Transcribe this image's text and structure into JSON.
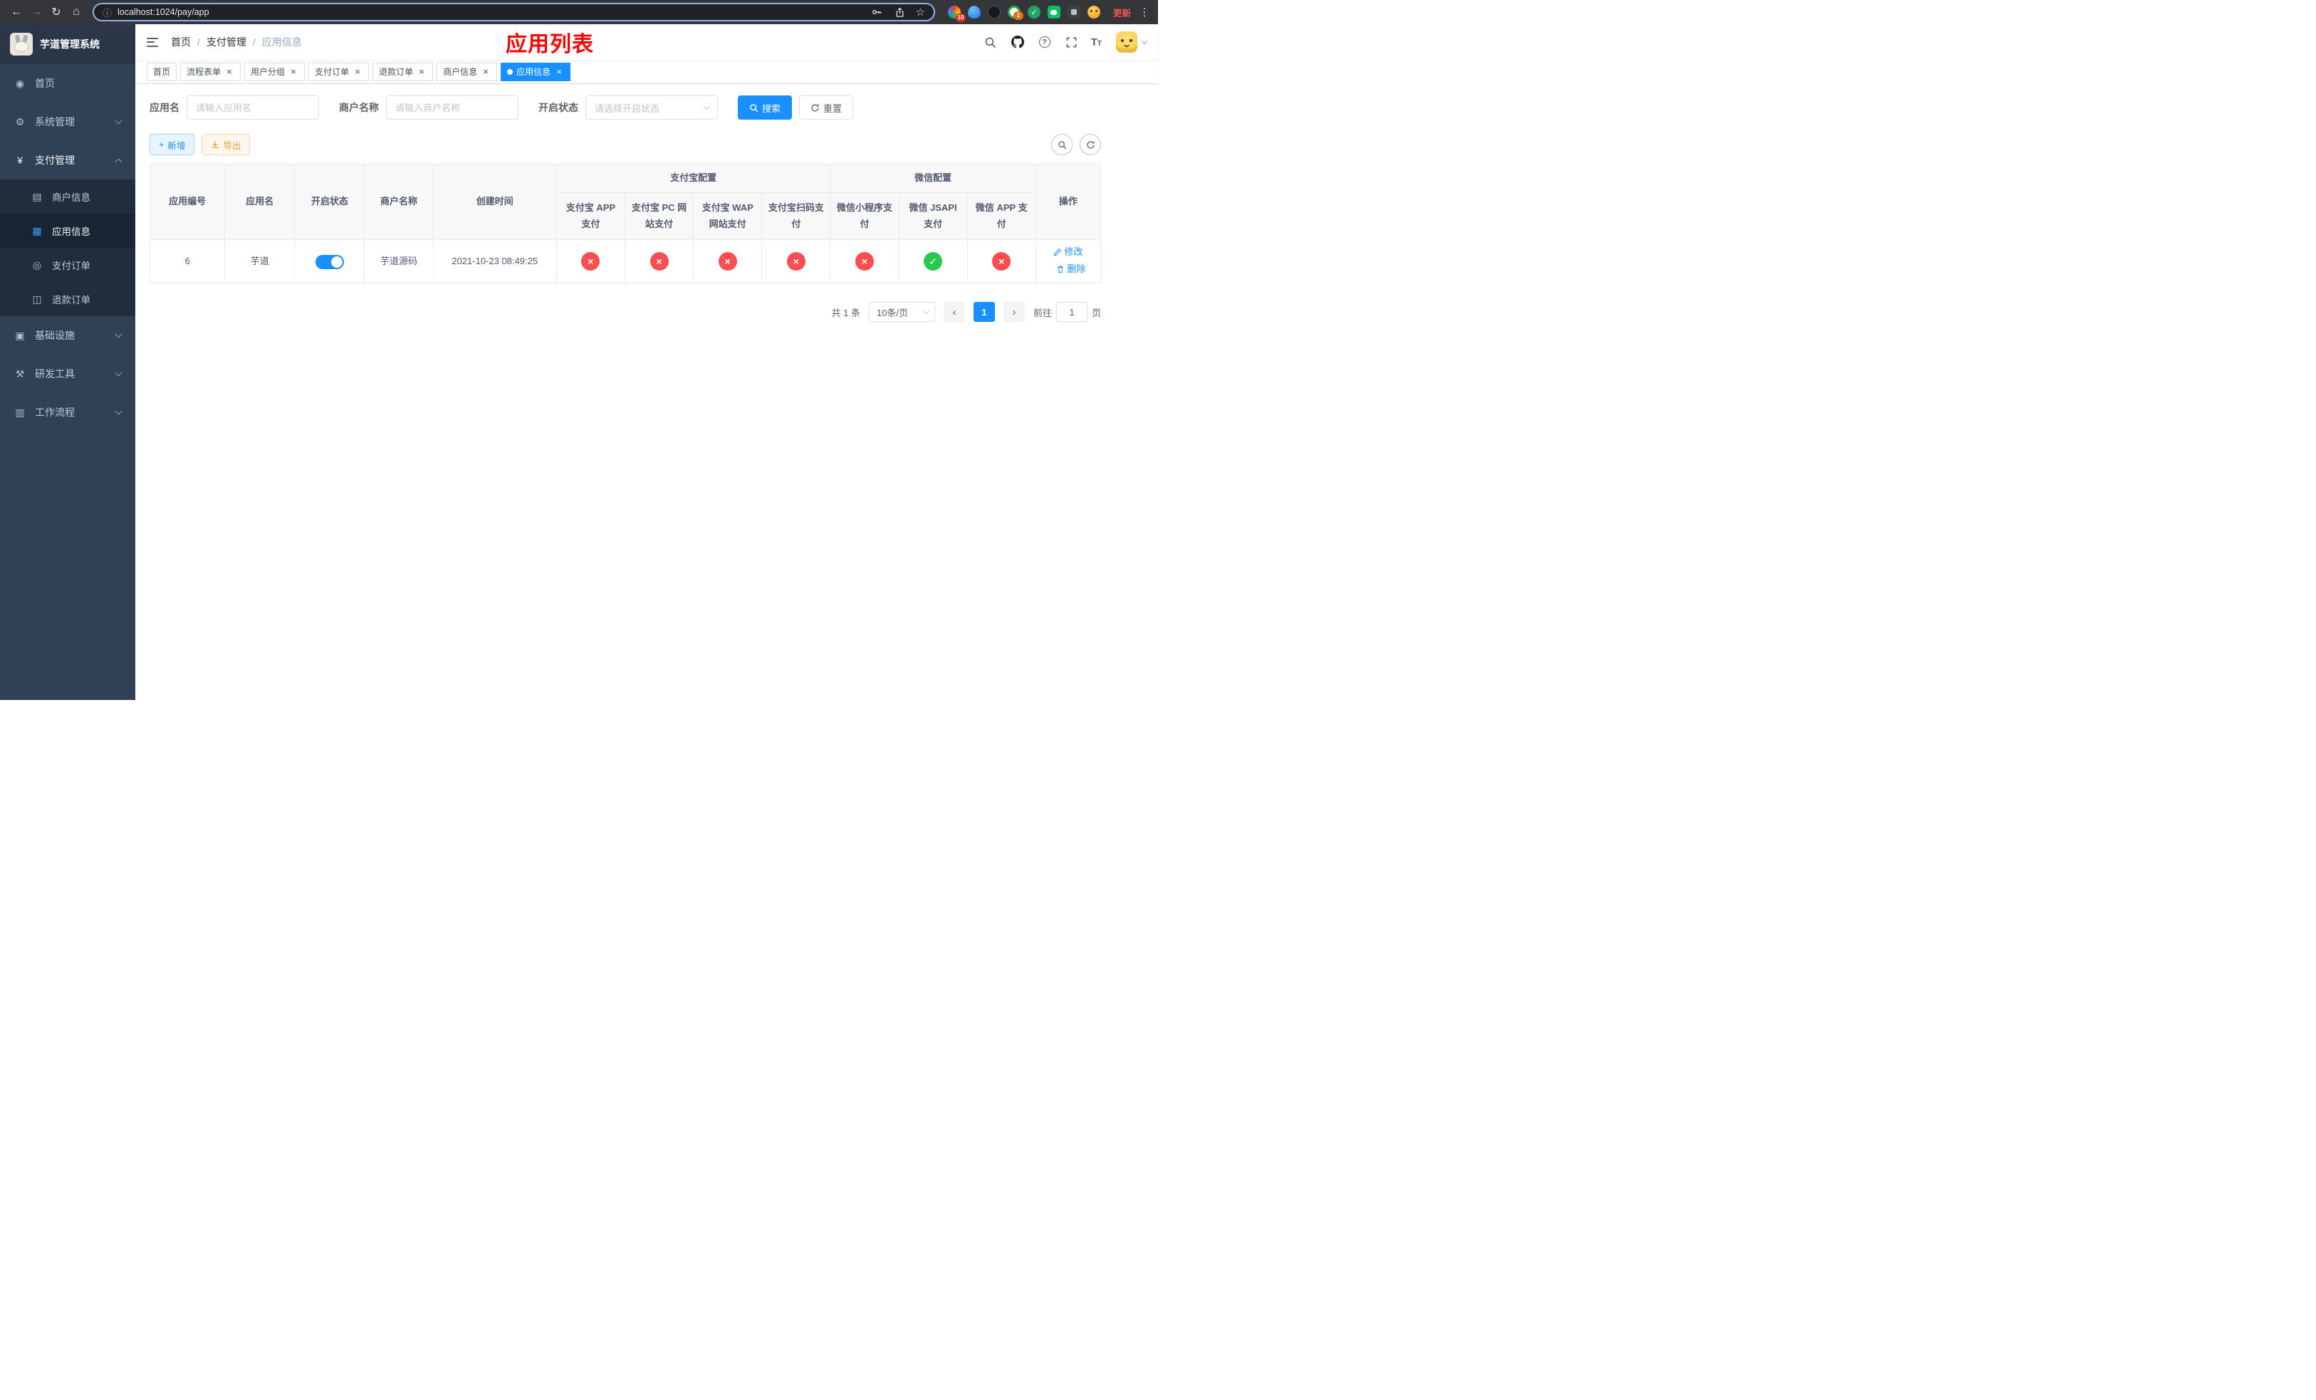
{
  "colors": {
    "primary": "#1890ff",
    "success": "#29c94e",
    "danger": "#fa4e50",
    "page_title_red": "#ff0000",
    "sidebar_bg": "#304156",
    "submenu_bg": "#1f2d3d"
  },
  "browser": {
    "url": "localhost:1024/pay/app",
    "update_label": "更新",
    "ext_badge_colorful": "10",
    "ext_badge_green": "1"
  },
  "sidebar": {
    "logo_title": "芋道管理系统",
    "menu": [
      {
        "label": "首页",
        "icon": "dashboard-icon"
      },
      {
        "label": "系统管理",
        "icon": "gear-icon"
      },
      {
        "label": "支付管理",
        "icon": "yen-icon"
      },
      {
        "label": "基础设施",
        "icon": "infrastructure-icon"
      },
      {
        "label": "研发工具",
        "icon": "devtools-icon"
      },
      {
        "label": "工作流程",
        "icon": "workflow-icon"
      }
    ],
    "pay_submenu": [
      {
        "label": "商户信息",
        "icon": "merchant-card-icon"
      },
      {
        "label": "应用信息",
        "icon": "app-grid-icon"
      },
      {
        "label": "支付订单",
        "icon": "pay-order-icon"
      },
      {
        "label": "退款订单",
        "icon": "refund-order-icon"
      }
    ]
  },
  "header": {
    "breadcrumb": [
      {
        "label": "首页"
      },
      {
        "label": "支付管理"
      },
      {
        "label": "应用信息"
      }
    ],
    "page_title": "应用列表"
  },
  "tabs": [
    {
      "label": "首页",
      "closable": false,
      "active": false
    },
    {
      "label": "流程表单",
      "closable": true,
      "active": false
    },
    {
      "label": "用户分组",
      "closable": true,
      "active": false
    },
    {
      "label": "支付订单",
      "closable": true,
      "active": false
    },
    {
      "label": "退款订单",
      "closable": true,
      "active": false
    },
    {
      "label": "商户信息",
      "closable": true,
      "active": false
    },
    {
      "label": "应用信息",
      "closable": true,
      "active": true
    }
  ],
  "filters": {
    "app_name_label": "应用名",
    "app_name_placeholder": "请输入应用名",
    "merchant_label": "商户名称",
    "merchant_placeholder": "请输入商户名称",
    "status_label": "开启状态",
    "status_placeholder": "请选择开启状态",
    "search_label": "搜索",
    "reset_label": "重置"
  },
  "toolbar": {
    "add_label": "新增",
    "export_label": "导出"
  },
  "table": {
    "columns": {
      "app_id": "应用编号",
      "app_name": "应用名",
      "status": "开启状态",
      "merchant": "商户名称",
      "create_time": "创建时间",
      "alipay_group": "支付宝配置",
      "wechat_group": "微信配置",
      "alipay_app": "支付宝 APP 支付",
      "alipay_pc": "支付宝 PC 网站支付",
      "alipay_wap": "支付宝 WAP 网站支付",
      "alipay_qr": "支付宝扫码支付",
      "wx_lite": "微信小程序支付",
      "wx_jsapi": "微信 JSAPI 支付",
      "wx_app": "微信 APP 支付",
      "actions": "操作"
    },
    "row": {
      "app_id": "6",
      "app_name": "芋道",
      "status_on": true,
      "merchant": "芋道源码",
      "create_time": "2021-10-23 08:49:25",
      "configs": [
        "off",
        "off",
        "off",
        "off",
        "off",
        "on",
        "off"
      ],
      "edit_label": "修改",
      "delete_label": "删除"
    }
  },
  "pagination": {
    "total_text": "共 1 条",
    "page_size_text": "10条/页",
    "current_page": "1",
    "goto_label": "前往",
    "goto_value": "1",
    "goto_suffix": "页"
  }
}
